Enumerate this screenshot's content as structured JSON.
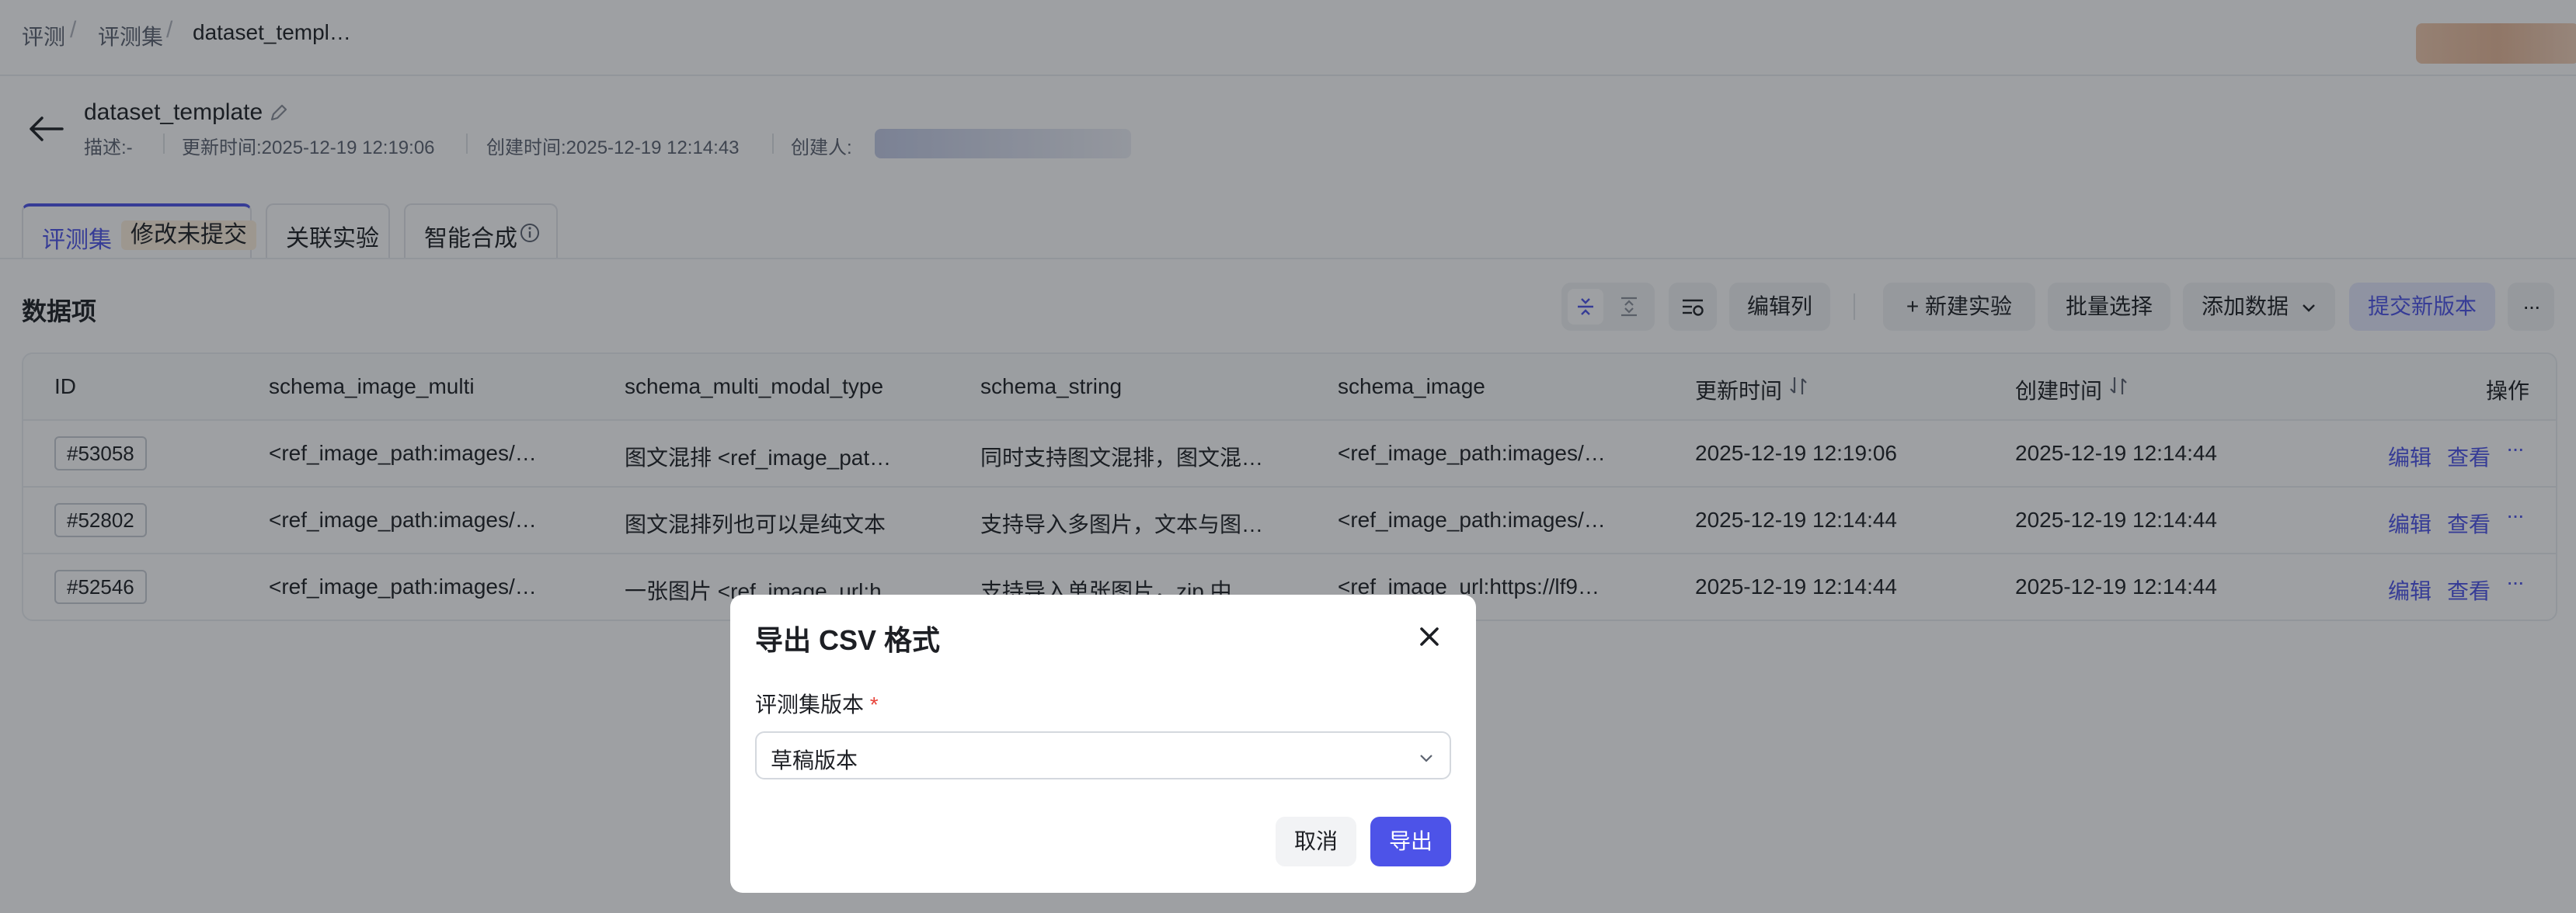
{
  "breadcrumb": {
    "items": [
      "评测",
      "评测集",
      "dataset_templ…"
    ]
  },
  "header": {
    "title": "dataset_template",
    "description": "描述:-",
    "updated": "更新时间:2025-12-19 12:19:06",
    "created": "创建时间:2025-12-19 12:14:43",
    "creator_label": "创建人:"
  },
  "tabs": [
    {
      "label": "评测集",
      "badge": "修改未提交"
    },
    {
      "label": "关联实验"
    },
    {
      "label": "智能合成"
    }
  ],
  "section": {
    "title": "数据项"
  },
  "toolbar": {
    "edit_columns": "编辑列",
    "new_experiment": "+ 新建实验",
    "batch_select": "批量选择",
    "add_data": "添加数据",
    "submit_version": "提交新版本",
    "more": "···"
  },
  "table": {
    "columns": [
      "ID",
      "schema_image_multi",
      "schema_multi_modal_type",
      "schema_string",
      "schema_image",
      "更新时间",
      "创建时间",
      "操作"
    ],
    "rows": [
      {
        "id": "#53058",
        "image_multi": "<ref_image_path:images/…",
        "multi_modal": "图文混排 <ref_image_pat…",
        "string": "同时支持图文混排，图文混…",
        "image": "<ref_image_path:images/…",
        "updated": "2025-12-19 12:19:06",
        "created": "2025-12-19 12:14:44"
      },
      {
        "id": "#52802",
        "image_multi": "<ref_image_path:images/…",
        "multi_modal": "图文混排列也可以是纯文本",
        "string": "支持导入多图片，文本与图…",
        "image": "<ref_image_path:images/…",
        "updated": "2025-12-19 12:14:44",
        "created": "2025-12-19 12:14:44"
      },
      {
        "id": "#52546",
        "image_multi": "<ref_image_path:images/…",
        "multi_modal": "一张图片 <ref_image_url:h…",
        "string": "支持导入单张图片，zip 中…",
        "image": "<ref_image_url:https://lf9…",
        "updated": "2025-12-19 12:14:44",
        "created": "2025-12-19 12:14:44"
      }
    ],
    "actions": {
      "edit": "编辑",
      "view": "查看",
      "more": "···"
    }
  },
  "modal": {
    "title": "导出 CSV 格式",
    "field_label": "评测集版本",
    "required_mark": "*",
    "select_value": "草稿版本",
    "cancel": "取消",
    "confirm": "导出"
  },
  "colors": {
    "accent": "#4d53e8",
    "badge_bg": "#fdf0dd",
    "badge_text": "#c97a16",
    "required": "#e8453c"
  }
}
